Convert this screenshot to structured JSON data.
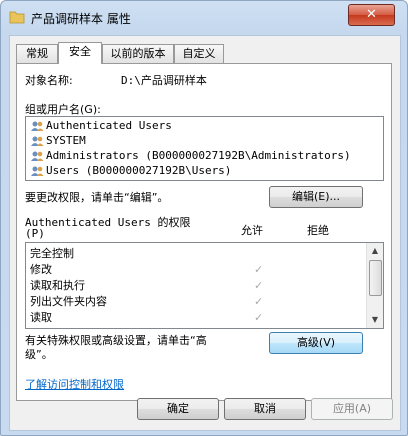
{
  "window": {
    "title": "产品调研样本 属性",
    "close_label": "✕"
  },
  "tabs": [
    {
      "label": "常规"
    },
    {
      "label": "安全"
    },
    {
      "label": "以前的版本"
    },
    {
      "label": "自定义"
    }
  ],
  "security": {
    "object_name_label": "对象名称:",
    "object_name_value": "D:\\产品调研样本",
    "groups_label": "组或用户名(G):",
    "users": [
      {
        "name": "Authenticated Users"
      },
      {
        "name": "SYSTEM"
      },
      {
        "name": "Administrators (B000000027192B\\Administrators)"
      },
      {
        "name": "Users (B000000027192B\\Users)"
      }
    ],
    "edit_hint": "要更改权限，请单击“编辑”。",
    "edit_button": "编辑(E)...",
    "perm_title_line1": "Authenticated Users 的权限",
    "perm_title_line2": "(P)",
    "allow_header": "允许",
    "deny_header": "拒绝",
    "permissions": [
      {
        "name": "完全控制",
        "allow": false
      },
      {
        "name": "修改",
        "allow": true
      },
      {
        "name": "读取和执行",
        "allow": true
      },
      {
        "name": "列出文件夹内容",
        "allow": true
      },
      {
        "name": "读取",
        "allow": true
      }
    ],
    "check_glyph": "✓",
    "advanced_hint_line1": "有关特殊权限或高级设置，请单击“高",
    "advanced_hint_line2": "级”。",
    "advanced_button": "高级(V)",
    "learn_link": "了解访问控制和权限"
  },
  "footer": {
    "ok": "确定",
    "cancel": "取消",
    "apply": "应用(A)"
  }
}
